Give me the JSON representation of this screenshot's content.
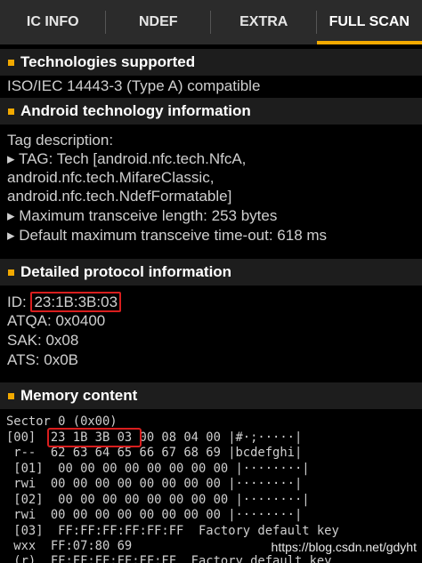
{
  "tabs": [
    {
      "label": "IC INFO",
      "active": false
    },
    {
      "label": "NDEF",
      "active": false
    },
    {
      "label": "EXTRA",
      "active": false
    },
    {
      "label": "FULL SCAN",
      "active": true
    }
  ],
  "accent_color": "#f2a900",
  "highlight_color": "#d91e1e",
  "sections": {
    "technologies": {
      "title": "Technologies supported",
      "lines": [
        "ISO/IEC 14443-3 (Type A) compatible"
      ]
    },
    "android": {
      "title": "Android technology information",
      "lines": [
        "Tag description:",
        "▸ TAG: Tech [android.nfc.tech.NfcA,",
        "android.nfc.tech.MifareClassic,",
        "android.nfc.tech.NdefFormatable]",
        "▸ Maximum transceive length: 253 bytes",
        "▸ Default maximum transceive time-out: 618 ms"
      ]
    },
    "protocol": {
      "title": "Detailed protocol information",
      "id_label": "ID: ",
      "id_value": "23:1B:3B:03",
      "lines": [
        "ATQA: 0x0400",
        "SAK: 0x08",
        "ATS: 0x0B"
      ]
    },
    "memory": {
      "title": "Memory content",
      "lines": [
        "Sector 0 (0x00)",
        "[00]  23 1B 3B 03 00 08 04 00 |#·;·····|",
        " r--  62 63 64 65 66 67 68 69 |bcdefghi|",
        " [01]  00 00 00 00 00 00 00 00 |········|",
        " rwi  00 00 00 00 00 00 00 00 |········|",
        " [02]  00 00 00 00 00 00 00 00 |········|",
        " rwi  00 00 00 00 00 00 00 00 |········|",
        " [03]  FF:FF:FF:FF:FF:FF  Factory default key",
        " wxx  FF:07:80 69",
        " (r)  FF:FF:FF:FF:FF:FF  Factory default key"
      ]
    }
  },
  "watermark": "https://blog.csdn.net/gdyht"
}
